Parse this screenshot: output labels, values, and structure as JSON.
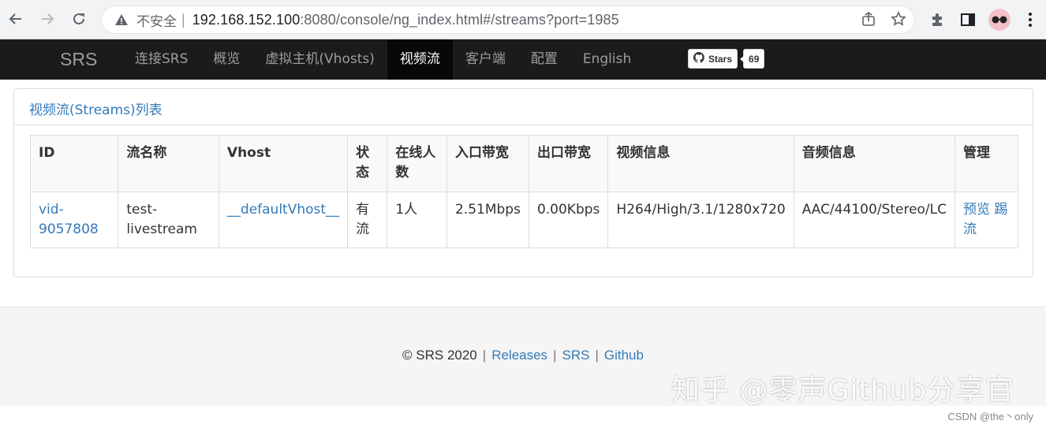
{
  "browser": {
    "security_label": "不安全",
    "url_host": "192.168.152.100",
    "url_rest": ":8080/console/ng_index.html#/streams?port=1985",
    "icons": [
      "back-icon",
      "forward-icon",
      "reload-icon",
      "warning-icon",
      "share-icon",
      "star-icon",
      "extensions-icon",
      "sidepanel-icon",
      "profile-avatar",
      "menu-icon"
    ]
  },
  "navbar": {
    "brand": "SRS",
    "items": [
      {
        "label": "连接SRS"
      },
      {
        "label": "概览"
      },
      {
        "label": "虚拟主机(Vhosts)"
      },
      {
        "label": "视频流",
        "active": true
      },
      {
        "label": "客户端"
      },
      {
        "label": "配置"
      },
      {
        "label": "English"
      }
    ],
    "github": {
      "label": "Stars",
      "count": "69"
    }
  },
  "panel": {
    "title": "视频流(Streams)列表",
    "columns": [
      "ID",
      "流名称",
      "Vhost",
      "状态",
      "在线人数",
      "入口带宽",
      "出口带宽",
      "视频信息",
      "音频信息",
      "管理"
    ],
    "rows": [
      {
        "id": "vid-9057808",
        "name": "test-livestream",
        "vhost": "__defaultVhost__",
        "status": "有流",
        "clients": "1人",
        "in_bw": "2.51Mbps",
        "out_bw": "0.00Kbps",
        "video": "H264/High/3.1/1280x720",
        "audio": "AAC/44100/Stereo/LC",
        "actions": [
          "预览",
          "踢流"
        ]
      }
    ]
  },
  "footer": {
    "copyright": "© SRS 2020",
    "links": [
      "Releases",
      "SRS",
      "Github"
    ]
  },
  "watermark": "知乎 @零声Github分享官",
  "credit": "CSDN @the丶only",
  "colors": {
    "link": "#337ab7",
    "navbar_bg": "#1b1b1b",
    "navbar_active": "#080808"
  }
}
